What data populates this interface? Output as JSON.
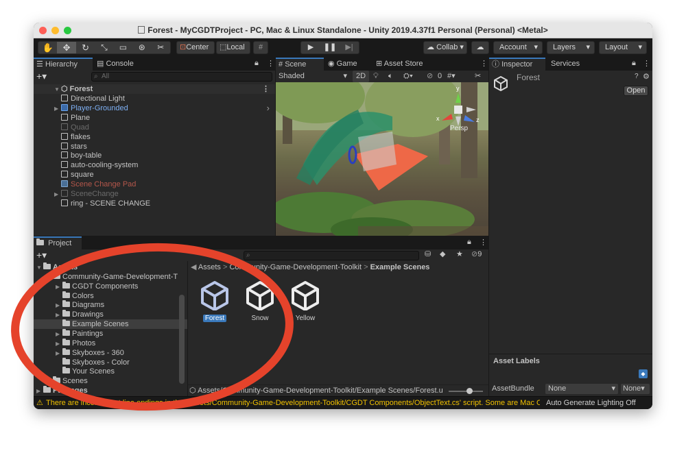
{
  "window": {
    "title": "Forest - MyCGDTProject - PC, Mac & Linux Standalone - Unity 2019.4.37f1 Personal (Personal) <Metal>"
  },
  "toolbar": {
    "center_label": "Center",
    "local_label": "Local",
    "collab_label": "Collab",
    "account_label": "Account",
    "layers_label": "Layers",
    "layout_label": "Layout"
  },
  "hierarchy": {
    "tabs": [
      "Hierarchy",
      "Console"
    ],
    "search_placeholder": "All",
    "scene_name": "Forest",
    "items": [
      {
        "label": "Directional Light",
        "style": "normal",
        "expandable": false
      },
      {
        "label": "Player-Grounded",
        "style": "prefab",
        "expandable": true
      },
      {
        "label": "Plane",
        "style": "normal",
        "expandable": false
      },
      {
        "label": "Quad",
        "style": "disabled",
        "expandable": false
      },
      {
        "label": "flakes",
        "style": "normal",
        "expandable": false
      },
      {
        "label": "stars",
        "style": "normal",
        "expandable": false
      },
      {
        "label": "boy-table",
        "style": "normal",
        "expandable": false
      },
      {
        "label": "auto-cooling-system",
        "style": "normal",
        "expandable": false
      },
      {
        "label": "square",
        "style": "normal",
        "expandable": false
      },
      {
        "label": "Scene Change Pad",
        "style": "missing",
        "expandable": false
      },
      {
        "label": "SceneChange",
        "style": "disabled",
        "expandable": true
      },
      {
        "label": "ring - SCENE CHANGE",
        "style": "normal",
        "expandable": false
      }
    ]
  },
  "scene": {
    "tabs": [
      "Scene",
      "Game",
      "Asset Store"
    ],
    "shading_mode": "Shaded",
    "mode_2d": "2D",
    "hidden_count": "0",
    "gizmo_axes": {
      "x": "x",
      "y": "y",
      "z": "z"
    },
    "persp_label": "Persp"
  },
  "inspector": {
    "tabs": [
      "Inspector",
      "Services"
    ],
    "object_name": "Forest",
    "open_button": "Open",
    "asset_labels_title": "Asset Labels",
    "asset_bundle_label": "AssetBundle",
    "asset_bundle_value": "None",
    "asset_bundle_variant": "None"
  },
  "project": {
    "tab": "Project",
    "hidden_count": "9",
    "tree": [
      {
        "label": "Assets",
        "depth": 0,
        "expanded": true,
        "selected": false
      },
      {
        "label": "Community-Game-Development-T",
        "depth": 1,
        "expanded": true,
        "selected": false
      },
      {
        "label": "CGDT Components",
        "depth": 2,
        "expanded": false,
        "selected": false
      },
      {
        "label": "Colors",
        "depth": 2,
        "expanded": null,
        "selected": false
      },
      {
        "label": "Diagrams",
        "depth": 2,
        "expanded": false,
        "selected": false
      },
      {
        "label": "Drawings",
        "depth": 2,
        "expanded": false,
        "selected": false
      },
      {
        "label": "Example Scenes",
        "depth": 2,
        "expanded": null,
        "selected": true
      },
      {
        "label": "Paintings",
        "depth": 2,
        "expanded": false,
        "selected": false
      },
      {
        "label": "Photos",
        "depth": 2,
        "expanded": false,
        "selected": false
      },
      {
        "label": "Skyboxes - 360",
        "depth": 2,
        "expanded": false,
        "selected": false
      },
      {
        "label": "Skyboxes - Color",
        "depth": 2,
        "expanded": null,
        "selected": false
      },
      {
        "label": "Your Scenes",
        "depth": 2,
        "expanded": null,
        "selected": false
      },
      {
        "label": "Scenes",
        "depth": 1,
        "expanded": null,
        "selected": false
      },
      {
        "label": "Packages",
        "depth": 0,
        "expanded": false,
        "selected": false
      }
    ],
    "breadcrumb": [
      "Assets",
      "Community-Game-Development-Toolkit",
      "Example Scenes"
    ],
    "assets": [
      {
        "label": "Forest",
        "selected": true
      },
      {
        "label": "Snow",
        "selected": false
      },
      {
        "label": "Yellow",
        "selected": false
      }
    ],
    "path_bar": "Assets/Community-Game-Development-Toolkit/Example Scenes/Forest.u"
  },
  "status": {
    "message": "There are inconsistent line endings in the 'Assets/Community-Game-Development-Toolkit/CGDT Components/ObjectText.cs' script. Some are Mac OS X (UNIX) and some are Windows.",
    "right_label": "Auto Generate Lighting Off"
  },
  "colors": {
    "accent": "#3a79bb",
    "annotation_ring": "#e5432b",
    "prefab_text": "#7fb1f5",
    "missing_text": "#b5574b",
    "warning": "#f2c200"
  }
}
